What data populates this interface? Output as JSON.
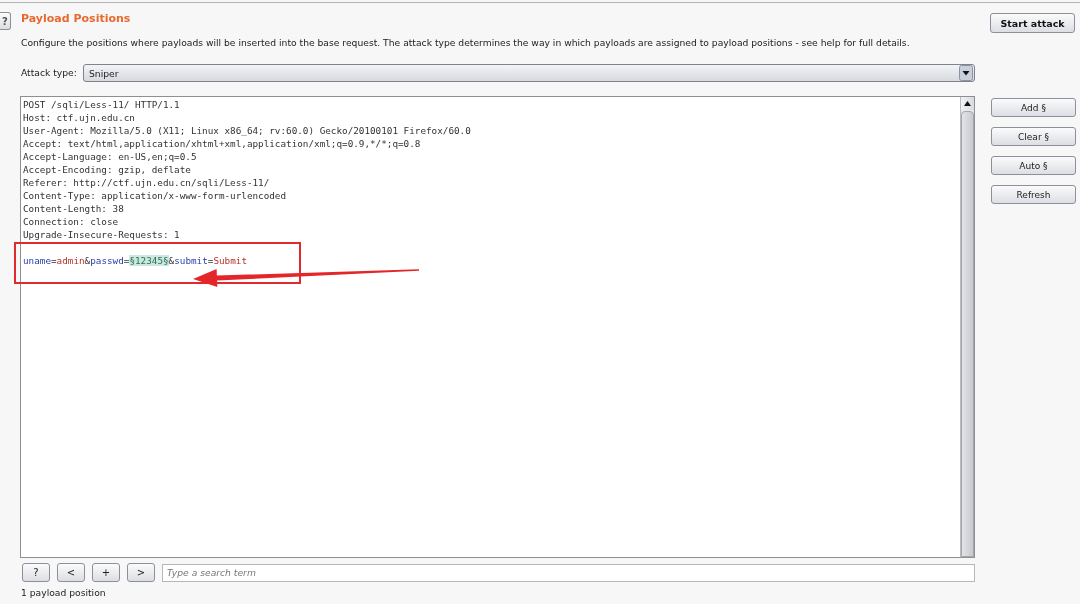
{
  "panel": {
    "help_button": "?",
    "title": "Payload Positions",
    "description": "Configure the positions where payloads will be inserted into the base request. The attack type determines the way in which payloads are assigned to payload positions - see help for full details.",
    "start_button": "Start attack"
  },
  "attack_type": {
    "label": "Attack type:",
    "value": "Sniper"
  },
  "request_editor": {
    "header_lines": [
      "POST /sqli/Less-11/ HTTP/1.1",
      "Host: ctf.ujn.edu.cn",
      "User-Agent: Mozilla/5.0 (X11; Linux x86_64; rv:60.0) Gecko/20100101 Firefox/60.0",
      "Accept: text/html,application/xhtml+xml,application/xml;q=0.9,*/*;q=0.8",
      "Accept-Language: en-US,en;q=0.5",
      "Accept-Encoding: gzip, deflate",
      "Referer: http://ctf.ujn.edu.cn/sqli/Less-11/",
      "Content-Type: application/x-www-form-urlencoded",
      "Content-Length: 38",
      "Connection: close",
      "Upgrade-Insecure-Requests: 1"
    ],
    "body": [
      {
        "kind": "name",
        "text": "uname"
      },
      {
        "kind": "operator",
        "text": "="
      },
      {
        "kind": "value",
        "text": "admin"
      },
      {
        "kind": "operator",
        "text": "&"
      },
      {
        "kind": "name",
        "text": "passwd"
      },
      {
        "kind": "operator",
        "text": "="
      },
      {
        "kind": "payload",
        "text": "§12345§"
      },
      {
        "kind": "operator",
        "text": "&"
      },
      {
        "kind": "name",
        "text": "submit"
      },
      {
        "kind": "operator",
        "text": "="
      },
      {
        "kind": "value",
        "text": "Submit"
      }
    ]
  },
  "position_buttons": [
    "Add §",
    "Clear §",
    "Auto §",
    "Refresh"
  ],
  "search_bar": {
    "buttons": [
      "?",
      "<",
      "+",
      ">"
    ],
    "placeholder": "Type a search term"
  },
  "status": "1 payload position"
}
